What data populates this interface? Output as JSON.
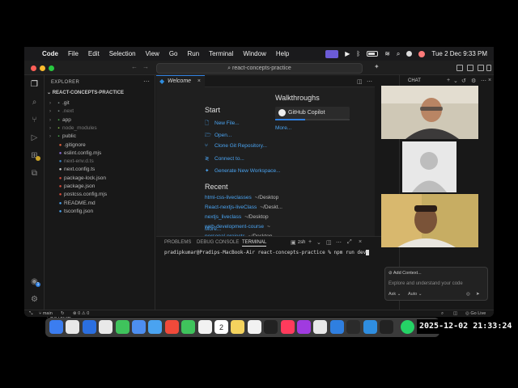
{
  "menubar": {
    "app": "Code",
    "menus": [
      "File",
      "Edit",
      "Selection",
      "View",
      "Go",
      "Run",
      "Terminal",
      "Window",
      "Help"
    ],
    "clock": "Tue 2 Dec  9:33 PM"
  },
  "titlebar": {
    "search": "react-concepts-practice"
  },
  "explorer": {
    "header": "EXPLORER",
    "project": "REACT-CONCEPTS-PRACTICE",
    "files": [
      {
        "name": ".git",
        "type": "folder",
        "color": "#bbbbbb",
        "icon_color": "#7f8c8d"
      },
      {
        "name": ".next",
        "type": "folder",
        "color": "#7a7a7a",
        "icon_color": "#7f8c8d"
      },
      {
        "name": "app",
        "type": "folder",
        "color": "#bbbbbb",
        "icon_color": "#4caf50"
      },
      {
        "name": "node_modules",
        "type": "folder",
        "color": "#7a7a7a",
        "icon_color": "#8bc34a"
      },
      {
        "name": "public",
        "type": "folder",
        "color": "#bbbbbb",
        "icon_color": "#4caf50"
      },
      {
        "name": ".gitignore",
        "type": "file",
        "color": "#bbbbbb",
        "icon_color": "#e0603c"
      },
      {
        "name": "eslint.config.mjs",
        "type": "file",
        "color": "#bbbbbb",
        "icon_color": "#8a6bd6"
      },
      {
        "name": "next-env.d.ts",
        "type": "file",
        "color": "#7a7a7a",
        "icon_color": "#3b82c4"
      },
      {
        "name": "next.config.ts",
        "type": "file",
        "color": "#bbbbbb",
        "icon_color": "#cccccc"
      },
      {
        "name": "package-lock.json",
        "type": "file",
        "color": "#bbbbbb",
        "icon_color": "#d84a3a"
      },
      {
        "name": "package.json",
        "type": "file",
        "color": "#bbbbbb",
        "icon_color": "#d84a3a"
      },
      {
        "name": "postcss.config.mjs",
        "type": "file",
        "color": "#bbbbbb",
        "icon_color": "#d84a3a"
      },
      {
        "name": "README.md",
        "type": "file",
        "color": "#bbbbbb",
        "icon_color": "#4aa3f0"
      },
      {
        "name": "tsconfig.json",
        "type": "file",
        "color": "#bbbbbb",
        "icon_color": "#4aa3f0"
      }
    ],
    "outline": "OUTLINE"
  },
  "editor": {
    "tab": "Welcome",
    "start_title": "Start",
    "start_items": [
      "New File...",
      "Open...",
      "Clone Git Repository...",
      "Connect to...",
      "Generate New Workspace..."
    ],
    "recent_title": "Recent",
    "recent": [
      {
        "name": "html-css-liveclasses",
        "path": "~/Desktop"
      },
      {
        "name": "React-nextjs-liveClass",
        "path": "~/Deskt..."
      },
      {
        "name": "nextjs_liveclass",
        "path": "~/Desktop"
      },
      {
        "name": "web-development-course",
        "path": "~"
      },
      {
        "name": "personal-projects",
        "path": "~/Desktop"
      }
    ],
    "recent_more": "More...",
    "walkthroughs_title": "Walkthroughs",
    "walkthrough": "GitHub Copilot",
    "walkthrough_progress": 0.4,
    "walkthroughs_more": "More..."
  },
  "panel": {
    "tabs": [
      "PROBLEMS",
      "DEBUG CONSOLE",
      "TERMINAL"
    ],
    "shell": "zsh",
    "prompt": "pradipkumar@Pradips-MacBook-Air react-concepts-practice % npm run dev"
  },
  "chat": {
    "title": "CHAT",
    "add_context": "Add Context...",
    "placeholder": "Explore and understand your code",
    "mode": "Ask",
    "model": "Auto"
  },
  "statusbar": {
    "branch": "main",
    "problems": "0",
    "warnings": "0",
    "go_live": "Go Live"
  },
  "dock": {
    "calendar_day": "2",
    "timestamp": "2025-12-02 21:33:24"
  }
}
